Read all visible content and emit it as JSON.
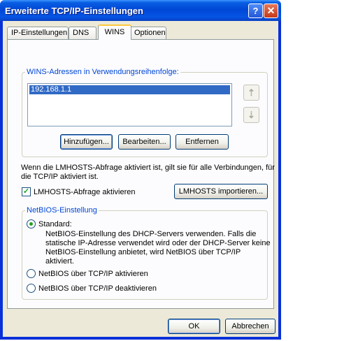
{
  "window": {
    "title": "Erweiterte TCP/IP-Einstellungen",
    "help_glyph": "?",
    "close_glyph": "✕"
  },
  "tabs": [
    {
      "label": "IP-Einstellungen"
    },
    {
      "label": "DNS"
    },
    {
      "label": "WINS",
      "selected": true
    },
    {
      "label": "Optionen"
    }
  ],
  "wins": {
    "legend": "WINS-Adressen in Verwendungsreihenfolge:",
    "addresses": [
      "192.168.1.1"
    ],
    "up_glyph": "⇡",
    "down_glyph": "⇣",
    "buttons": {
      "add": "Hinzufügen...",
      "edit": "Bearbeiten...",
      "remove": "Entfernen"
    }
  },
  "lmhosts": {
    "info_line1": "Wenn die LMHOSTS-Abfrage aktiviert ist, gilt sie für alle Verbindungen, für",
    "info_line2": "die TCP/IP aktiviert ist.",
    "checkbox_label": "LMHOSTS-Abfrage aktivieren",
    "checked": true,
    "import_button": "LMHOSTS importieren..."
  },
  "netbios": {
    "legend": "NetBIOS-Einstellung",
    "options": [
      {
        "label": "Standard:",
        "selected": true
      },
      {
        "label": "NetBIOS über TCP/IP aktivieren",
        "selected": false
      },
      {
        "label": "NetBIOS über TCP/IP deaktivieren",
        "selected": false
      }
    ],
    "standard_desc": [
      "NetBIOS-Einstellung des DHCP-Servers verwenden. Falls die",
      "statische IP-Adresse verwendet wird oder der DHCP-Server keine",
      "NetBIOS-Einstellung anbietet, wird NetBIOS über TCP/IP",
      "aktiviert."
    ]
  },
  "footer": {
    "ok": "OK",
    "cancel": "Abbrechen"
  },
  "colors": {
    "title_bar": "#0a5fe3",
    "dialog_bg": "#ece9d8",
    "selection": "#316ac5",
    "group_label": "#0046d5"
  }
}
